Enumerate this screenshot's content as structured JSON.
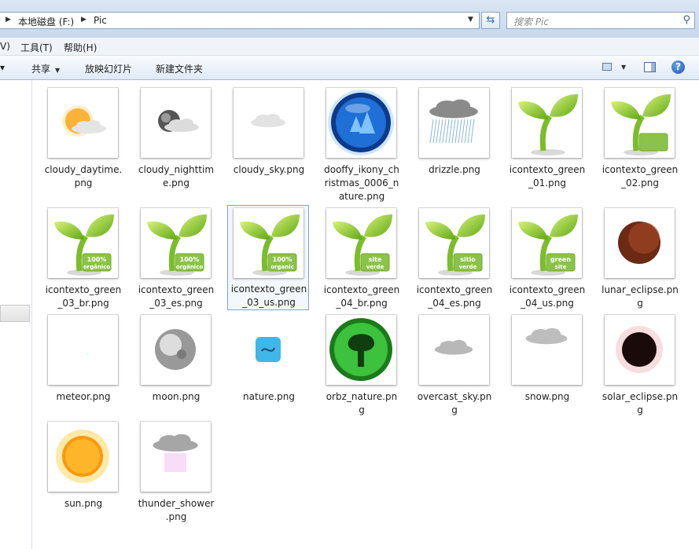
{
  "address": {
    "segments": [
      "本地磁盘 (F:)",
      "Pic"
    ]
  },
  "search": {
    "placeholder": "搜索 Pic"
  },
  "menu": {
    "items": [
      "V)",
      "工具(T)",
      "帮助(H)"
    ]
  },
  "commands": {
    "share": "共享",
    "slideshow": "放映幻灯片",
    "new_folder": "新建文件夹"
  },
  "files": [
    {
      "name": "cloudy_daytime.png",
      "label": [
        "cloudy_daytime.",
        "png"
      ],
      "icon": "cloudy-daytime-icon"
    },
    {
      "name": "cloudy_nighttime.png",
      "label": [
        "cloudy_nighttim",
        "e.png"
      ],
      "icon": "cloudy-nighttime-icon"
    },
    {
      "name": "cloudy_sky.png",
      "label": [
        "cloudy_sky.png"
      ],
      "icon": "cloudy-sky-icon"
    },
    {
      "name": "dooffy_ikony_christmas_0006_nature.png",
      "label": [
        "dooffy_ikony_ch",
        "ristmas_0006_n",
        "ature.png"
      ],
      "icon": "blue-globe-icon"
    },
    {
      "name": "drizzle.png",
      "label": [
        "drizzle.png"
      ],
      "icon": "drizzle-icon"
    },
    {
      "name": "icontexto_green_01.png",
      "label": [
        "icontexto_green",
        "_01.png"
      ],
      "icon": "green-sprout-icon"
    },
    {
      "name": "icontexto_green_02.png",
      "label": [
        "icontexto_green",
        "_02.png"
      ],
      "icon": "green-sprout-icon"
    },
    {
      "name": "icontexto_green_03_br.png",
      "label": [
        "icontexto_green",
        "_03_br.png"
      ],
      "icon": "green-sprout-icon",
      "badge": "100% orgânico"
    },
    {
      "name": "icontexto_green_03_es.png",
      "label": [
        "icontexto_green",
        "_03_es.png"
      ],
      "icon": "green-sprout-icon",
      "badge": "100% orgánico"
    },
    {
      "name": "icontexto_green_03_us.png",
      "label": [
        "icontexto_green",
        "_03_us.png"
      ],
      "icon": "green-sprout-icon",
      "badge": "100% organic",
      "selected": true
    },
    {
      "name": "icontexto_green_04_br.png",
      "label": [
        "icontexto_green",
        "_04_br.png"
      ],
      "icon": "green-sprout-icon",
      "badge": "site verde"
    },
    {
      "name": "icontexto_green_04_es.png",
      "label": [
        "icontexto_green",
        "_04_es.png"
      ],
      "icon": "green-sprout-icon",
      "badge": "sitio verde"
    },
    {
      "name": "icontexto_green_04_us.png",
      "label": [
        "icontexto_green",
        "_04_us.png"
      ],
      "icon": "green-sprout-icon",
      "badge": "green site"
    },
    {
      "name": "lunar_eclipse.png",
      "label": [
        "lunar_eclipse.pn",
        "g"
      ],
      "icon": "lunar-eclipse-icon"
    },
    {
      "name": "meteor.png",
      "label": [
        "meteor.png"
      ],
      "icon": "meteor-icon"
    },
    {
      "name": "moon.png",
      "label": [
        "moon.png"
      ],
      "icon": "moon-icon"
    },
    {
      "name": "nature.png",
      "label": [
        "nature.png"
      ],
      "icon": "nature-icon"
    },
    {
      "name": "orbz_nature.png",
      "label": [
        "orbz_nature.pn",
        "g"
      ],
      "icon": "green-tree-orb-icon"
    },
    {
      "name": "overcast_sky.png",
      "label": [
        "overcast_sky.pn",
        "g"
      ],
      "icon": "overcast-sky-icon"
    },
    {
      "name": "snow.png",
      "label": [
        "snow.png"
      ],
      "icon": "snow-icon"
    },
    {
      "name": "solar_eclipse.png",
      "label": [
        "solar_eclipse.pn",
        "g"
      ],
      "icon": "solar-eclipse-icon"
    },
    {
      "name": "sun.png",
      "label": [
        "sun.png"
      ],
      "icon": "sun-icon"
    },
    {
      "name": "thunder_shower.png",
      "label": [
        "thunder_shower",
        ".png"
      ],
      "icon": "thunder-shower-icon"
    }
  ]
}
